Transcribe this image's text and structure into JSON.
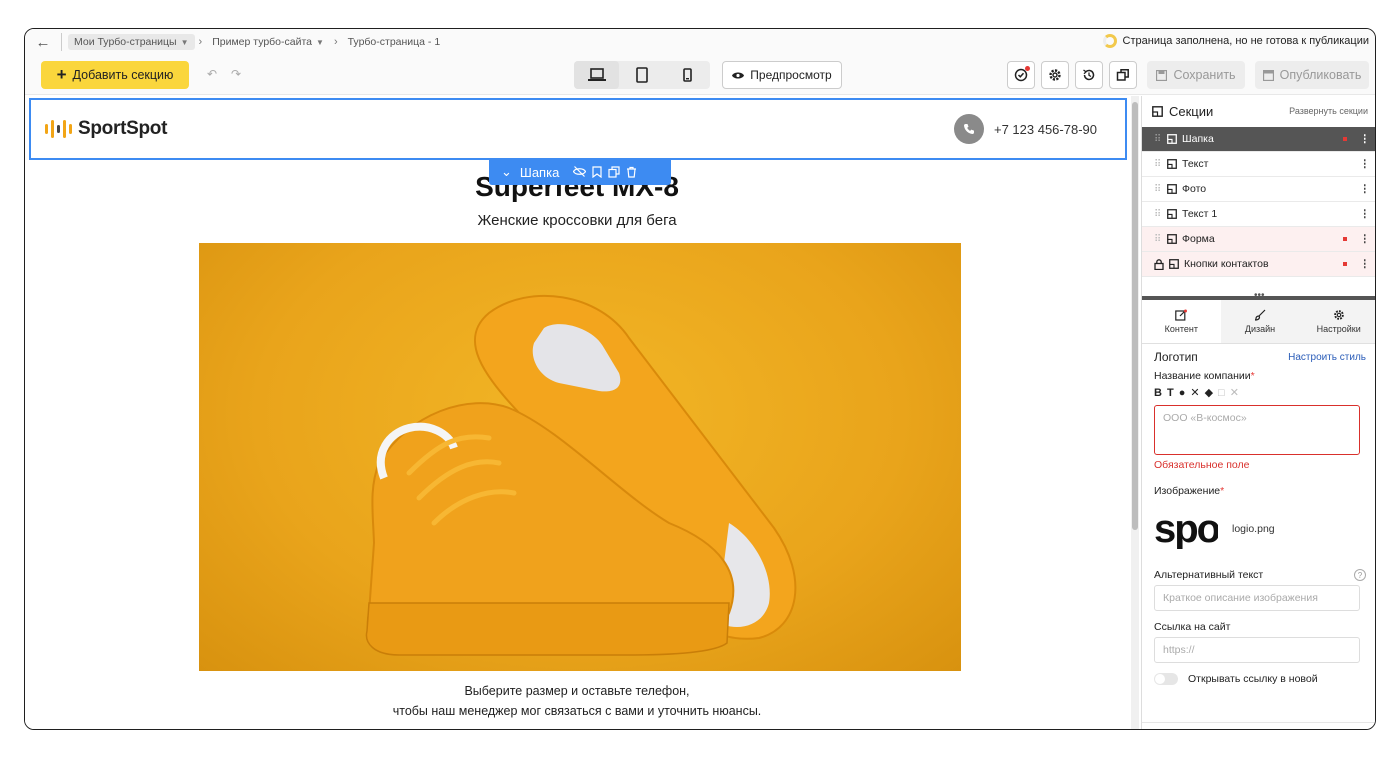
{
  "breadcrumbs": [
    {
      "label": "Мои Турбо-страницы",
      "has_dropdown": true
    },
    {
      "label": "Пример турбо-сайта",
      "has_dropdown": true
    },
    {
      "label": "Турбо-страница - 1",
      "has_dropdown": false
    }
  ],
  "status": {
    "text": "Страница заполнена, но не готова к публикации"
  },
  "toolbar": {
    "add_section": "Добавить секцию",
    "preview": "Предпросмотр",
    "save": "Сохранить",
    "publish": "Опубликовать",
    "active_device": "desktop"
  },
  "site": {
    "logo_text": "SportSpot",
    "phone": "+7 123 456-78-90",
    "title": "Superfeet MX-8",
    "subtitle": "Женские кроссовки для бега",
    "desc_line1": "Выберите размер и оставьте телефон,",
    "desc_line2": "чтобы наш менеджер мог связаться с вами и уточнить нюансы."
  },
  "section_tag": {
    "label": "Шапка"
  },
  "panel": {
    "sections_title": "Секции",
    "expand_link": "Развернуть секции",
    "sections": [
      {
        "label": "Шапка",
        "active": true,
        "error": true,
        "locked": false
      },
      {
        "label": "Текст",
        "active": false,
        "error": false,
        "locked": false
      },
      {
        "label": "Фото",
        "active": false,
        "error": false,
        "locked": false
      },
      {
        "label": "Текст 1",
        "active": false,
        "error": false,
        "locked": false
      },
      {
        "label": "Форма",
        "active": false,
        "error": true,
        "locked": false
      },
      {
        "label": "Кнопки контактов",
        "active": false,
        "error": true,
        "locked": true
      }
    ],
    "tabs": [
      "Контент",
      "Дизайн",
      "Настройки"
    ],
    "active_tab": "Контент",
    "form": {
      "group_title": "Логотип",
      "style_link": "Настроить стиль",
      "company_label": "Название компании",
      "company_placeholder": "ООО «В-космос»",
      "required_error": "Обязательное поле",
      "image_label": "Изображение",
      "image_preview": "spo",
      "image_file": "logio.png",
      "alt_label": "Альтернативный текст",
      "alt_placeholder": "Краткое описание изображения",
      "link_label": "Ссылка на сайт",
      "link_placeholder": "https://",
      "open_new_label": "Открывать ссылку в новой"
    }
  }
}
